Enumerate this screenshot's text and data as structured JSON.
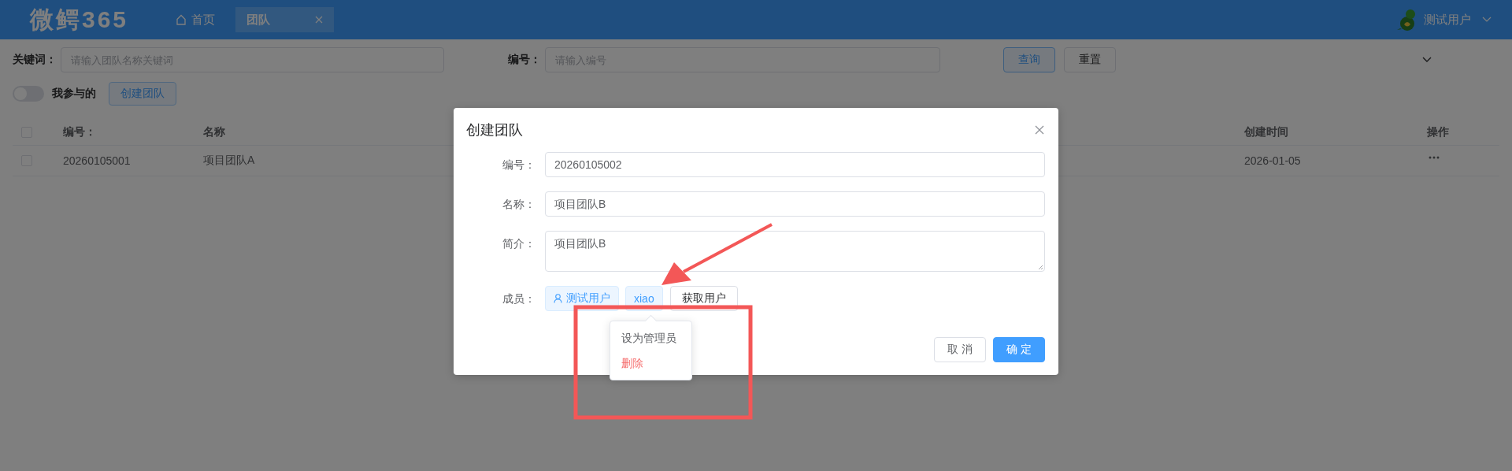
{
  "header": {
    "logo": "微鳄365",
    "tabs": [
      {
        "label": "首页",
        "kind": "home",
        "selected": false
      },
      {
        "label": "团队",
        "kind": "closable",
        "selected": true
      }
    ],
    "user": {
      "name": "测试用户"
    }
  },
  "filters": {
    "keyword": {
      "label": "关键词：",
      "placeholder": "请输入团队名称关键词"
    },
    "number": {
      "label": "编号：",
      "placeholder": "请输入编号"
    },
    "buttons": [
      {
        "label": "查询",
        "kind": "primary"
      },
      {
        "label": "重置",
        "kind": "default"
      }
    ],
    "switch": {
      "label": "我参与的",
      "on": false
    },
    "create_button": "创建团队"
  },
  "table": {
    "header_checked": false,
    "columns": [
      "编号：",
      "名称",
      "创建时间",
      "操作"
    ],
    "rows": [
      {
        "checked": false,
        "cells": [
          "20260105001",
          "项目团队A",
          "2026-01-05"
        ]
      }
    ]
  },
  "dialog": {
    "title": "创建团队",
    "fields": [
      {
        "label": "编号：",
        "kind": "input",
        "value": "20260105002"
      },
      {
        "label": "名称：",
        "kind": "input",
        "value": "项目团队B"
      },
      {
        "label": "简介：",
        "kind": "textarea",
        "value": "项目团队B"
      }
    ],
    "members_label": "成员：",
    "members": [
      {
        "name": "测试用户",
        "kind": "user"
      },
      {
        "name": "xiao",
        "kind": "text"
      }
    ],
    "fetch_button": "获取用户",
    "member_menu": [
      {
        "label": "设为管理员",
        "kind": "normal"
      },
      {
        "label": "删除",
        "kind": "danger"
      }
    ],
    "buttons": [
      {
        "label": "取 消",
        "kind": "default"
      },
      {
        "label": "确 定",
        "kind": "primary"
      }
    ]
  }
}
